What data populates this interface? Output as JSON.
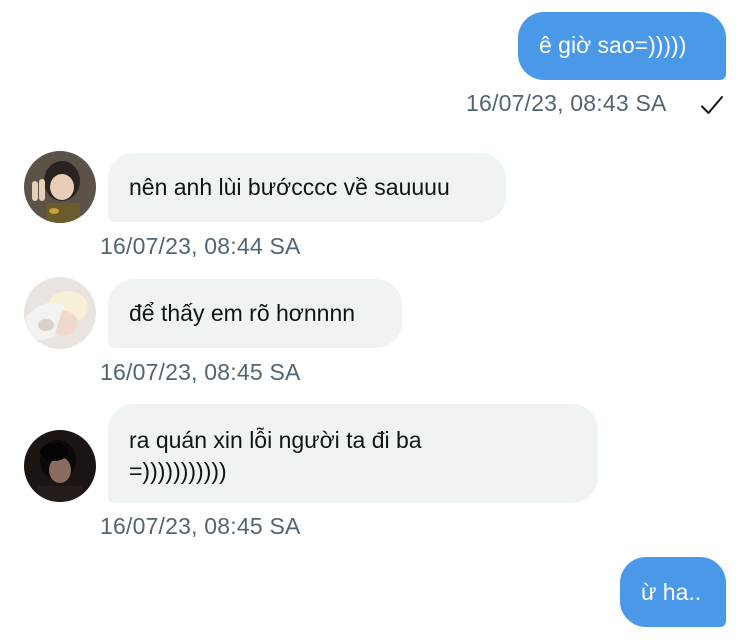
{
  "messages": [
    {
      "direction": "outgoing",
      "text": "ê giờ sao=)))))",
      "timestamp": "16/07/23, 08:43 SA",
      "status": "check-icon"
    },
    {
      "direction": "incoming",
      "text": "nên anh lùi bướcccc về sauuuu",
      "timestamp": "16/07/23, 08:44 SA",
      "avatar": "avatar-1"
    },
    {
      "direction": "incoming",
      "text": "để thấy em rõ hơnnnn",
      "timestamp": "16/07/23, 08:45 SA",
      "avatar": "avatar-2"
    },
    {
      "direction": "incoming",
      "text_lines": [
        "ra quán xin lỗi người ta đi ba",
        "=)))))))))))"
      ],
      "timestamp": "16/07/23, 08:45 SA",
      "avatar": "avatar-3"
    },
    {
      "direction": "outgoing",
      "text": "ừ ha.."
    }
  ],
  "colors": {
    "outgoing_bubble": "#4a99e9",
    "incoming_bubble": "#eff3f4",
    "timestamp": "#536471"
  }
}
